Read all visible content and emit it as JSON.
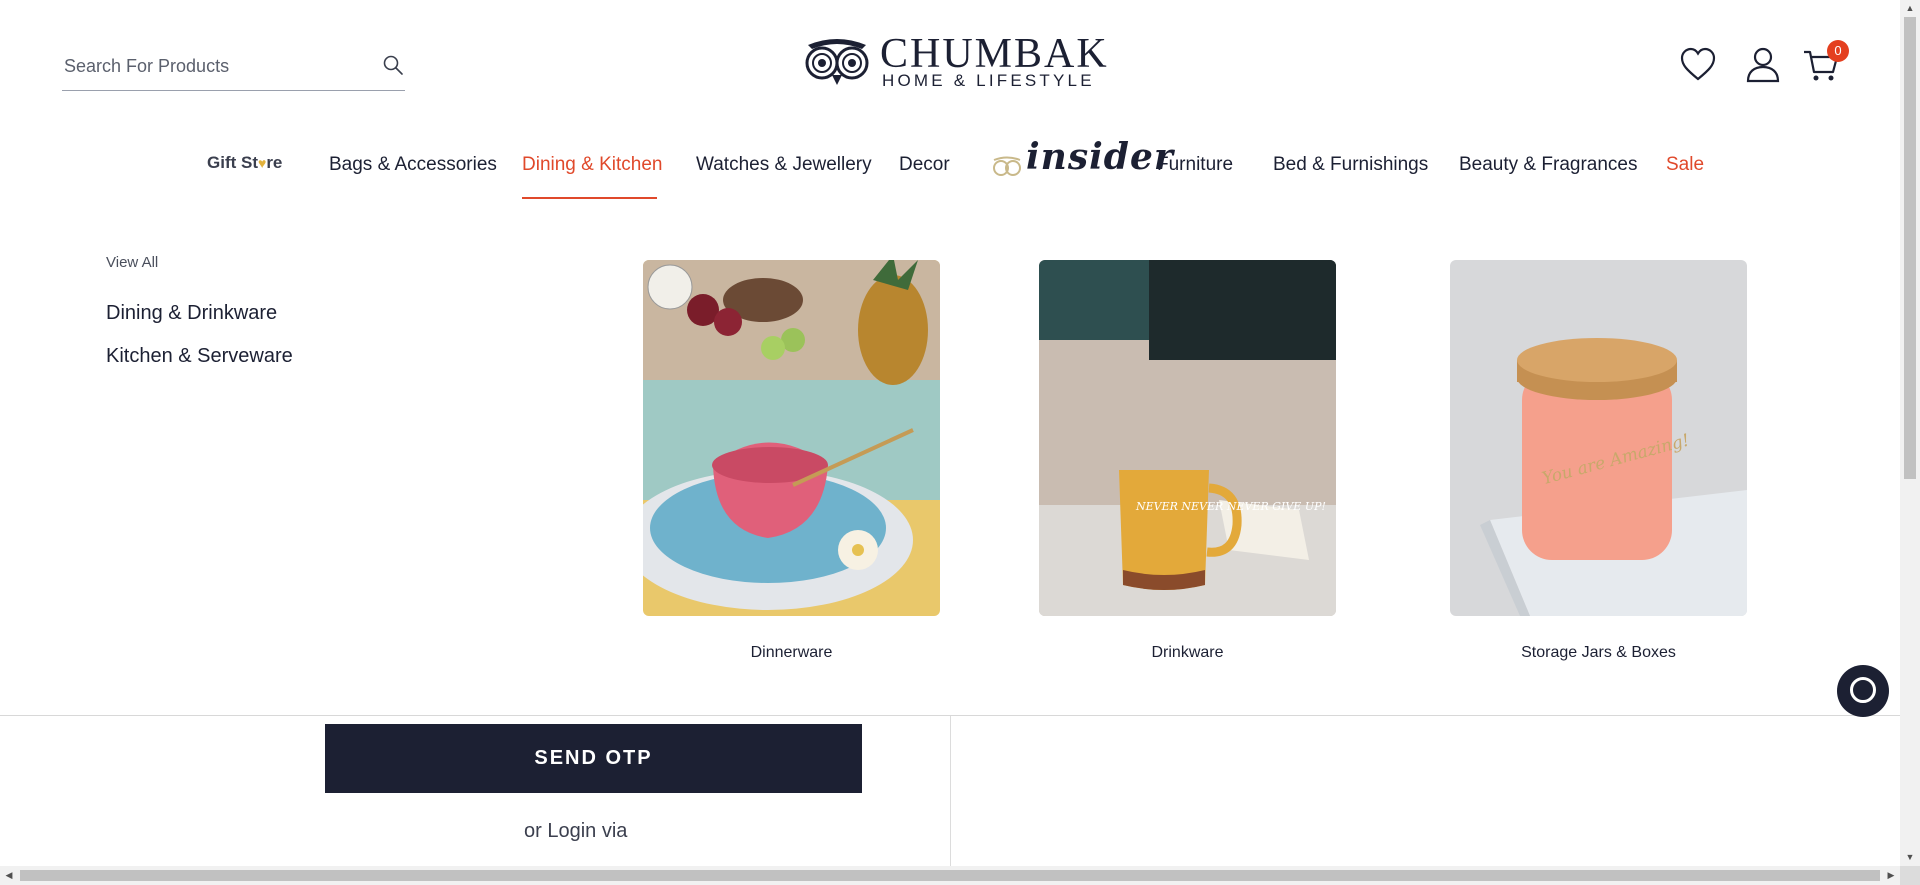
{
  "header": {
    "search": {
      "placeholder": "Search For Products",
      "icon": "search-icon"
    },
    "logo": {
      "brand": "CHUMBAK",
      "tagline": "HOME & LIFESTYLE"
    },
    "icons": [
      "wishlist-heart-icon",
      "account-user-icon",
      "cart-icon"
    ],
    "cart_count": "0"
  },
  "nav": {
    "gift_store": {
      "text_before": "Gift St",
      "glyph": "♥",
      "text_after": "re"
    },
    "items": [
      "Bags & Accessories",
      "Dining & Kitchen",
      "Watches & Jewellery",
      "Decor",
      "Furniture",
      "Bed & Furnishings",
      "Beauty & Fragrances",
      "Sale"
    ],
    "insider_label": "insider",
    "active": "Dining & Kitchen"
  },
  "mega_menu": {
    "view_all": "View All",
    "links": [
      "Dining & Drinkware",
      "Kitchen & Serveware"
    ],
    "tiles": [
      {
        "caption": "Dinnerware"
      },
      {
        "caption": "Drinkware",
        "mug_text": "NEVER NEVER NEVER GIVE UP!"
      },
      {
        "caption": "Storage Jars & Boxes",
        "jar_text": "You are Amazing!"
      }
    ]
  },
  "login": {
    "send_otp": "SEND OTP",
    "or_login": "or Login via"
  },
  "colors": {
    "accent": "#e0492b",
    "navy": "#1c2033",
    "badge": "#e43f1f"
  }
}
